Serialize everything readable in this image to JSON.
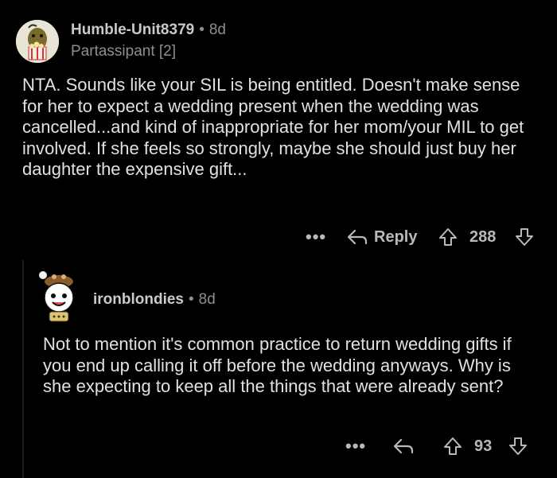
{
  "comments": [
    {
      "username": "Humble-Unit8379",
      "separator": "•",
      "age": "8d",
      "flair": "Partassipant [2]",
      "body": "NTA. Sounds like your SIL is being entitled. Doesn't make sense for her to expect a wedding present when the wedding was cancelled...and kind of inappropriate for her mom/your MIL to get involved. If she feels so strongly, maybe she should just buy her daughter the expensive gift...",
      "actions": {
        "more": "•••",
        "reply_label": "Reply",
        "score": "288"
      }
    },
    {
      "username": "ironblondies",
      "separator": "•",
      "age": "8d",
      "body": "Not to mention it's common practice to return wedding gifts if you end up calling it off before the wedding anyways. Why is she expecting to keep all the things that were already sent?",
      "actions": {
        "more": "•••",
        "score": "93"
      }
    }
  ],
  "colors": {
    "background": "#000000",
    "text": "#dfe1e3",
    "meta": "#8b8f92",
    "icon": "#b6babd"
  },
  "icons": {
    "reply": "reply-arrow-icon",
    "upvote": "upvote-arrow-icon",
    "downvote": "downvote-arrow-icon",
    "more": "more-dots-icon"
  }
}
